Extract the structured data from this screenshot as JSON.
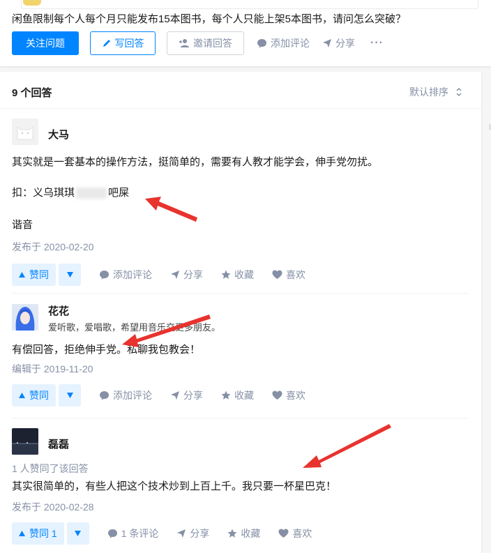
{
  "question": {
    "title": "闲鱼限制每个人每个月只能发布15本图书，每个人只能上架5本图书，请问怎么突破？",
    "follow_label": "关注问题",
    "write_label": "写回答",
    "invite_label": "邀请回答",
    "comment_label": "添加评论",
    "share_label": "分享",
    "more_label": "···"
  },
  "list": {
    "count_label": "9 个回答",
    "sort_label": "默认排序"
  },
  "answers": [
    {
      "author": "大马",
      "bio": "",
      "paragraphs": [
        "其实就是一套基本的操作方法，挺简单的，需要有人教才能学会，伸手党勿扰。",
        "扣：义乌琪琪",
        "吧屎",
        "谐音"
      ],
      "date": "发布于 2020-02-20",
      "upvote": "赞同",
      "comment": "添加评论",
      "share": "分享",
      "collect": "收藏",
      "like": "喜欢"
    },
    {
      "author": "花花",
      "bio": "爱听歌，爱唱歌，希望用音乐交更多朋友。",
      "paragraphs": [
        "有偿回答，拒绝伸手党。私聊我包教会！"
      ],
      "date": "编辑于 2019-11-20",
      "upvote": "赞同",
      "comment": "添加评论",
      "share": "分享",
      "collect": "收藏",
      "like": "喜欢"
    },
    {
      "author": "磊磊",
      "bio": "",
      "votes_note": "1 人赞同了该回答",
      "paragraphs": [
        "其实很简单的，有些人把这个技术炒到上百上千。我只要一杯星巴克！"
      ],
      "date": "发布于 2020-02-28",
      "upvote": "赞同 1",
      "comment": "1 条评论",
      "share": "分享",
      "collect": "收藏",
      "like": "喜欢"
    }
  ],
  "colors": {
    "brand": "#0084ff",
    "muted": "#8590a6",
    "vote_bg": "#e5f2ff",
    "arrow": "#e8332e"
  }
}
